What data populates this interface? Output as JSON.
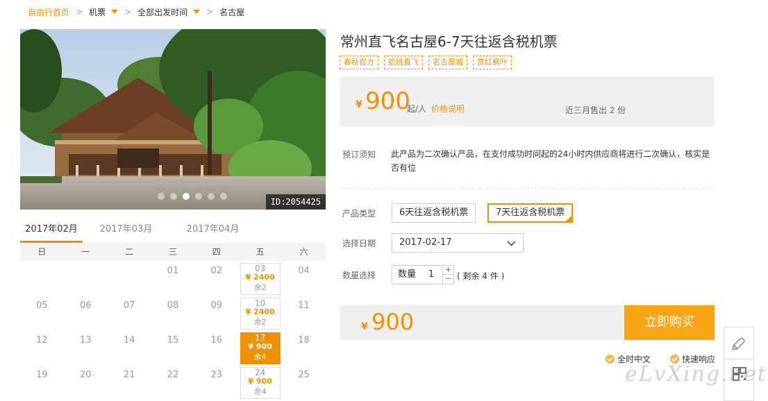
{
  "breadcrumb": {
    "home": "自由行首页",
    "flights": "机票",
    "departure": "全部出发时间",
    "destination": "名古屋"
  },
  "gallery": {
    "image_id": "ID:2054425",
    "dots_count": 6,
    "active_dot": 2
  },
  "calendar": {
    "months": [
      "2017年02月",
      "2017年03月",
      "2017年04月"
    ],
    "active_month": 0,
    "weekdays": [
      "日",
      "一",
      "二",
      "三",
      "四",
      "五",
      "六"
    ],
    "weeks": [
      [
        {
          "day": ""
        },
        {
          "day": ""
        },
        {
          "day": ""
        },
        {
          "day": "01"
        },
        {
          "day": "02"
        },
        {
          "day": "03",
          "price": "¥ 2400",
          "left": "余2"
        },
        {
          "day": "04"
        }
      ],
      [
        {
          "day": "05"
        },
        {
          "day": "06"
        },
        {
          "day": "07"
        },
        {
          "day": "08"
        },
        {
          "day": "09"
        },
        {
          "day": "10",
          "price": "¥ 2400",
          "left": "余2"
        },
        {
          "day": "11"
        }
      ],
      [
        {
          "day": "12"
        },
        {
          "day": "13"
        },
        {
          "day": "14"
        },
        {
          "day": "15"
        },
        {
          "day": "16"
        },
        {
          "day": "17",
          "price": "¥ 900",
          "left": "余4",
          "selected": true
        },
        {
          "day": "18"
        }
      ],
      [
        {
          "day": "19"
        },
        {
          "day": "20"
        },
        {
          "day": "21"
        },
        {
          "day": "22"
        },
        {
          "day": "23"
        },
        {
          "day": "24",
          "price": "¥ 900",
          "left": "余4"
        },
        {
          "day": "25"
        }
      ]
    ]
  },
  "product": {
    "title": "常州直飞名古屋6-7天往返含税机票",
    "tags": [
      "春秋官方",
      "航班直飞",
      "名古屋城",
      "赏红枫叶"
    ],
    "currency": "¥",
    "price": "900",
    "per_person": "起/人",
    "price_explain": "价格说明",
    "sold": "近三月售出 2 份",
    "notice_label": "预订须知",
    "notice_text": "此产品为二次确认产品，在支付成功时间起的24小时内供应商将进行二次确认，核实是否有位",
    "type_label": "产品类型",
    "types": [
      "6天往返含税机票",
      "7天往返含税机票"
    ],
    "active_type": 1,
    "date_label": "选择日期",
    "date_value": "2017-02-17",
    "qty_label": "数量选择",
    "qty_inner_label": "数量",
    "qty_value": "1",
    "qty_plus": "+",
    "qty_minus": "−",
    "remaining": "( 剩余 4 件 )",
    "total_currency": "¥",
    "total": "900",
    "buy_label": "立即购买",
    "assurances": [
      "全时中文",
      "快速响应"
    ]
  },
  "watermark": "eLvXing.net",
  "colors": {
    "accent": "#f09200",
    "buy_button": "#f9a514",
    "panel_bg": "#f0f0f0"
  }
}
